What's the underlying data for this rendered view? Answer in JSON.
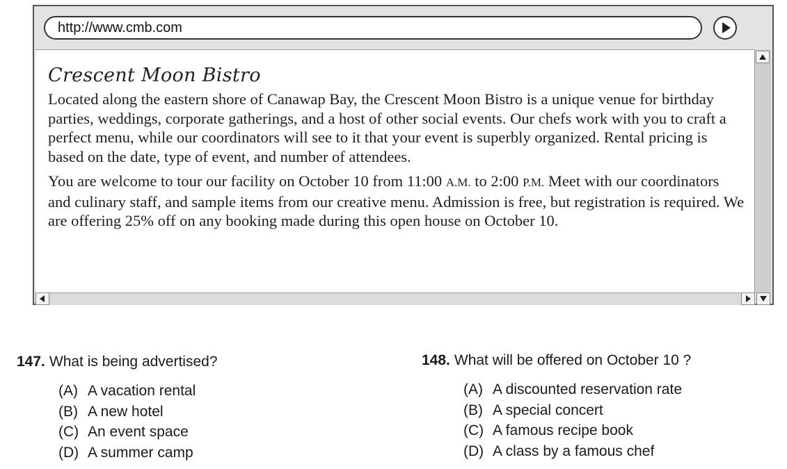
{
  "browser": {
    "url": "http://www.cmb.com"
  },
  "page": {
    "title": "Crescent Moon Bistro",
    "paragraph1": "Located along the eastern shore of Canawap Bay, the Crescent Moon Bistro is a unique venue for birthday parties, weddings, corporate gatherings, and a host of other social events. Our chefs work with you to craft a perfect menu, while our coordinators will see to it that your event is superbly organized. Rental pricing is based on the date, type of event, and number of attendees.",
    "paragraph2": {
      "part1": "You are welcome to tour our facility on October 10 from 11:00 ",
      "am": "A.M.",
      "part2": " to 2:00 ",
      "pm": "P.M.",
      "part3": " Meet with our coordinators and culinary staff, and sample items from our creative menu. Admission is free, but registration is required. We are offering 25% off on any booking made during this open house on October 10."
    }
  },
  "questions": [
    {
      "number": "147.",
      "text": "What is being advertised?",
      "options": [
        {
          "letter": "(A)",
          "text": "A vacation rental"
        },
        {
          "letter": "(B)",
          "text": "A new hotel"
        },
        {
          "letter": "(C)",
          "text": "An event space"
        },
        {
          "letter": "(D)",
          "text": "A summer camp"
        }
      ]
    },
    {
      "number": "148.",
      "text": "What will be offered on October 10 ?",
      "options": [
        {
          "letter": "(A)",
          "text": "A discounted reservation rate"
        },
        {
          "letter": "(B)",
          "text": "A special concert"
        },
        {
          "letter": "(C)",
          "text": "A famous recipe book"
        },
        {
          "letter": "(D)",
          "text": "A class by a famous chef"
        }
      ]
    }
  ]
}
